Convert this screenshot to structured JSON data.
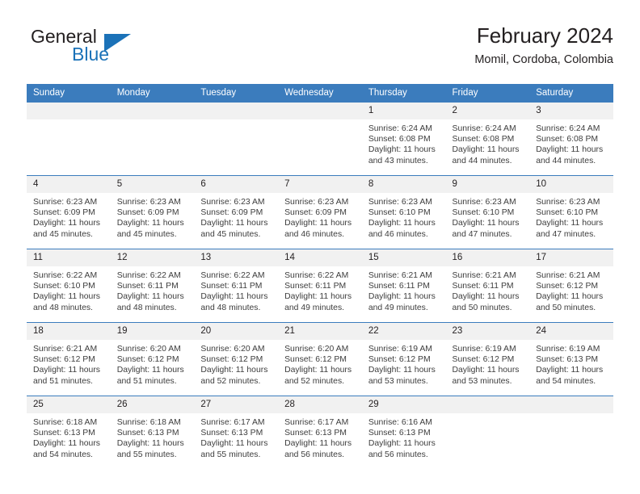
{
  "brand": {
    "word1": "General",
    "word2": "Blue",
    "accent_color": "#1b72b8",
    "triangle_icon": "brand-triangle-icon"
  },
  "header": {
    "title": "February 2024",
    "subtitle": "Momil, Cordoba, Colombia"
  },
  "calendar": {
    "header_bg": "#3b7cbd",
    "daynum_bg": "#f1f1f1",
    "weekdays": [
      "Sunday",
      "Monday",
      "Tuesday",
      "Wednesday",
      "Thursday",
      "Friday",
      "Saturday"
    ],
    "labels": {
      "sunrise": "Sunrise:",
      "sunset": "Sunset:",
      "daylight": "Daylight:"
    },
    "weeks": [
      [
        {
          "day": "",
          "blank": true
        },
        {
          "day": "",
          "blank": true
        },
        {
          "day": "",
          "blank": true
        },
        {
          "day": "",
          "blank": true
        },
        {
          "day": "1",
          "sunrise": "Sunrise: 6:24 AM",
          "sunset": "Sunset: 6:08 PM",
          "daylight": "Daylight: 11 hours and 43 minutes."
        },
        {
          "day": "2",
          "sunrise": "Sunrise: 6:24 AM",
          "sunset": "Sunset: 6:08 PM",
          "daylight": "Daylight: 11 hours and 44 minutes."
        },
        {
          "day": "3",
          "sunrise": "Sunrise: 6:24 AM",
          "sunset": "Sunset: 6:08 PM",
          "daylight": "Daylight: 11 hours and 44 minutes."
        }
      ],
      [
        {
          "day": "4",
          "sunrise": "Sunrise: 6:23 AM",
          "sunset": "Sunset: 6:09 PM",
          "daylight": "Daylight: 11 hours and 45 minutes."
        },
        {
          "day": "5",
          "sunrise": "Sunrise: 6:23 AM",
          "sunset": "Sunset: 6:09 PM",
          "daylight": "Daylight: 11 hours and 45 minutes."
        },
        {
          "day": "6",
          "sunrise": "Sunrise: 6:23 AM",
          "sunset": "Sunset: 6:09 PM",
          "daylight": "Daylight: 11 hours and 45 minutes."
        },
        {
          "day": "7",
          "sunrise": "Sunrise: 6:23 AM",
          "sunset": "Sunset: 6:09 PM",
          "daylight": "Daylight: 11 hours and 46 minutes."
        },
        {
          "day": "8",
          "sunrise": "Sunrise: 6:23 AM",
          "sunset": "Sunset: 6:10 PM",
          "daylight": "Daylight: 11 hours and 46 minutes."
        },
        {
          "day": "9",
          "sunrise": "Sunrise: 6:23 AM",
          "sunset": "Sunset: 6:10 PM",
          "daylight": "Daylight: 11 hours and 47 minutes."
        },
        {
          "day": "10",
          "sunrise": "Sunrise: 6:23 AM",
          "sunset": "Sunset: 6:10 PM",
          "daylight": "Daylight: 11 hours and 47 minutes."
        }
      ],
      [
        {
          "day": "11",
          "sunrise": "Sunrise: 6:22 AM",
          "sunset": "Sunset: 6:10 PM",
          "daylight": "Daylight: 11 hours and 48 minutes."
        },
        {
          "day": "12",
          "sunrise": "Sunrise: 6:22 AM",
          "sunset": "Sunset: 6:11 PM",
          "daylight": "Daylight: 11 hours and 48 minutes."
        },
        {
          "day": "13",
          "sunrise": "Sunrise: 6:22 AM",
          "sunset": "Sunset: 6:11 PM",
          "daylight": "Daylight: 11 hours and 48 minutes."
        },
        {
          "day": "14",
          "sunrise": "Sunrise: 6:22 AM",
          "sunset": "Sunset: 6:11 PM",
          "daylight": "Daylight: 11 hours and 49 minutes."
        },
        {
          "day": "15",
          "sunrise": "Sunrise: 6:21 AM",
          "sunset": "Sunset: 6:11 PM",
          "daylight": "Daylight: 11 hours and 49 minutes."
        },
        {
          "day": "16",
          "sunrise": "Sunrise: 6:21 AM",
          "sunset": "Sunset: 6:11 PM",
          "daylight": "Daylight: 11 hours and 50 minutes."
        },
        {
          "day": "17",
          "sunrise": "Sunrise: 6:21 AM",
          "sunset": "Sunset: 6:12 PM",
          "daylight": "Daylight: 11 hours and 50 minutes."
        }
      ],
      [
        {
          "day": "18",
          "sunrise": "Sunrise: 6:21 AM",
          "sunset": "Sunset: 6:12 PM",
          "daylight": "Daylight: 11 hours and 51 minutes."
        },
        {
          "day": "19",
          "sunrise": "Sunrise: 6:20 AM",
          "sunset": "Sunset: 6:12 PM",
          "daylight": "Daylight: 11 hours and 51 minutes."
        },
        {
          "day": "20",
          "sunrise": "Sunrise: 6:20 AM",
          "sunset": "Sunset: 6:12 PM",
          "daylight": "Daylight: 11 hours and 52 minutes."
        },
        {
          "day": "21",
          "sunrise": "Sunrise: 6:20 AM",
          "sunset": "Sunset: 6:12 PM",
          "daylight": "Daylight: 11 hours and 52 minutes."
        },
        {
          "day": "22",
          "sunrise": "Sunrise: 6:19 AM",
          "sunset": "Sunset: 6:12 PM",
          "daylight": "Daylight: 11 hours and 53 minutes."
        },
        {
          "day": "23",
          "sunrise": "Sunrise: 6:19 AM",
          "sunset": "Sunset: 6:12 PM",
          "daylight": "Daylight: 11 hours and 53 minutes."
        },
        {
          "day": "24",
          "sunrise": "Sunrise: 6:19 AM",
          "sunset": "Sunset: 6:13 PM",
          "daylight": "Daylight: 11 hours and 54 minutes."
        }
      ],
      [
        {
          "day": "25",
          "sunrise": "Sunrise: 6:18 AM",
          "sunset": "Sunset: 6:13 PM",
          "daylight": "Daylight: 11 hours and 54 minutes."
        },
        {
          "day": "26",
          "sunrise": "Sunrise: 6:18 AM",
          "sunset": "Sunset: 6:13 PM",
          "daylight": "Daylight: 11 hours and 55 minutes."
        },
        {
          "day": "27",
          "sunrise": "Sunrise: 6:17 AM",
          "sunset": "Sunset: 6:13 PM",
          "daylight": "Daylight: 11 hours and 55 minutes."
        },
        {
          "day": "28",
          "sunrise": "Sunrise: 6:17 AM",
          "sunset": "Sunset: 6:13 PM",
          "daylight": "Daylight: 11 hours and 56 minutes."
        },
        {
          "day": "29",
          "sunrise": "Sunrise: 6:16 AM",
          "sunset": "Sunset: 6:13 PM",
          "daylight": "Daylight: 11 hours and 56 minutes."
        },
        {
          "day": "",
          "blank": true
        },
        {
          "day": "",
          "blank": true
        }
      ]
    ]
  }
}
